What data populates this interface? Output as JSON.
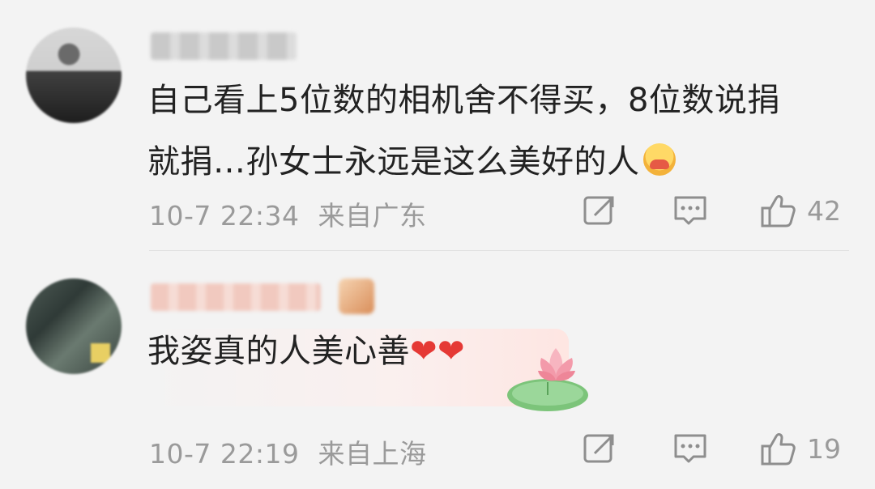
{
  "comments": [
    {
      "username": "",
      "text_line1": "自己看上5位数的相机舍不得买，8位数说捐",
      "text_line2": "就捐…孙女士永远是这么美好的人",
      "timestamp": "10-7 22:34",
      "location": "来自广东",
      "likes": "42",
      "emoji": "hugging-face-icon"
    },
    {
      "username": "",
      "text": "我姿真的人美心善",
      "hearts": "❤❤",
      "timestamp": "10-7 22:19",
      "location": "来自上海",
      "likes": "19",
      "decoration": "lotus-icon"
    }
  ],
  "icons": {
    "share": "share-icon",
    "reply": "comment-icon",
    "like": "thumbs-up-icon"
  },
  "colors": {
    "background": "#f3f3f3",
    "text": "#222222",
    "meta": "#9a9a9a",
    "heart": "#e53935"
  }
}
